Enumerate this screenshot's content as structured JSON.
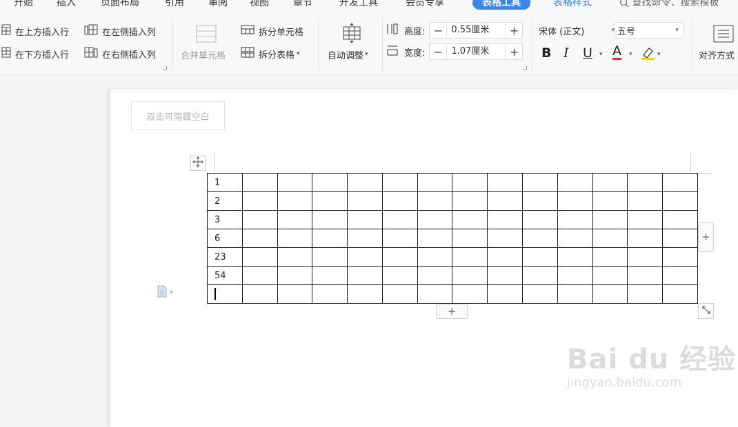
{
  "tabs": [
    {
      "label": "开始"
    },
    {
      "label": "插入"
    },
    {
      "label": "页面布局"
    },
    {
      "label": "引用"
    },
    {
      "label": "审阅"
    },
    {
      "label": "视图"
    },
    {
      "label": "章节"
    },
    {
      "label": "开发工具"
    },
    {
      "label": "会员专享"
    },
    {
      "label": "表格工具"
    },
    {
      "label": "表格样式"
    }
  ],
  "search_label": "查找命令、搜索模板",
  "ribbon": {
    "insert_above": "在上方插入行",
    "insert_below": "在下方插入行",
    "insert_left": "在左侧插入列",
    "insert_right": "在右侧插入列",
    "merge_cells": "合并单元格",
    "split_cells": "拆分单元格",
    "split_table": "拆分表格",
    "auto_fit": "自动调整",
    "height_label": "高度:",
    "height_value": "0.55厘米",
    "width_label": "宽度:",
    "width_value": "1.07厘米",
    "font_name": "宋体 (正文)",
    "font_size": "五号",
    "align_label": "对齐方式"
  },
  "document": {
    "hide_blank_label": "双击可隐藏空白",
    "table": {
      "columns": 14,
      "first_column": [
        "1",
        "2",
        "3",
        "6",
        "23",
        "54",
        ""
      ]
    }
  },
  "watermark": {
    "brand": "Bai du 经验",
    "url": "jingyan.baidu.com"
  }
}
